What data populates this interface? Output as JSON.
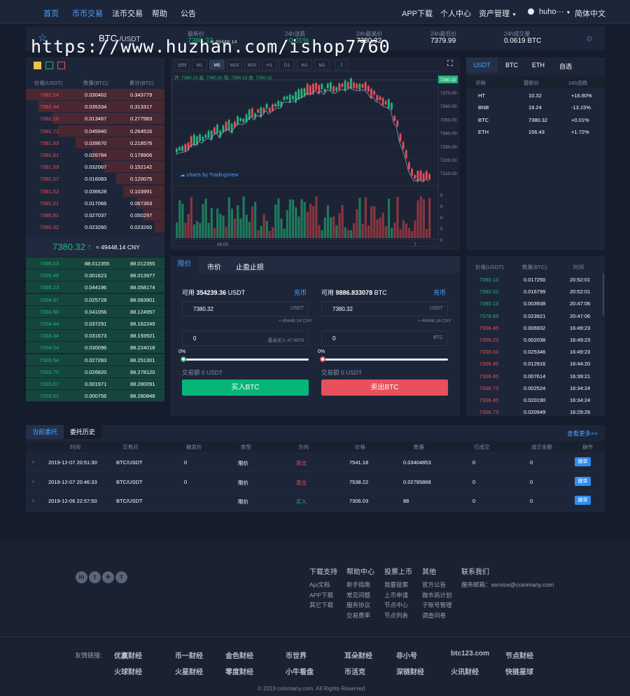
{
  "nav": {
    "left": [
      "首页",
      "币币交易",
      "法币交易",
      "帮助",
      "公告"
    ],
    "right": {
      "app": "APP下载",
      "center": "个人中心",
      "assets": "资产管理",
      "user": "huho···",
      "lang": "简体中文"
    }
  },
  "ticker": {
    "base": "BTC",
    "quote": "/USDT",
    "last_label": "最新价",
    "last": "7380.32",
    "last_cny": "¥ 49448.14",
    "change_label": "24h涨跌",
    "change": "+0.01%",
    "high_label": "24h最高价",
    "high": "7380.32",
    "low_label": "24h最低价",
    "low": "7379.99",
    "vol_label": "24h成交量",
    "vol": "0.0619 BTC"
  },
  "watermark": "https://www.huzhan.com/ishop7760",
  "orderbook": {
    "headers": [
      "价格(USDT)",
      "数量(BTC)",
      "累计(BTC)"
    ],
    "asks": [
      {
        "price": "7382.54",
        "qty": "0.030462",
        "total": "0.343779",
        "depth": 1.0
      },
      {
        "price": "7382.44",
        "qty": "0.035334",
        "total": "0.313317",
        "depth": 0.91
      },
      {
        "price": "7382.16",
        "qty": "0.013467",
        "total": "0.277983",
        "depth": 0.81
      },
      {
        "price": "7381.71",
        "qty": "0.045940",
        "total": "0.264516",
        "depth": 0.77
      },
      {
        "price": "7381.63",
        "qty": "0.039670",
        "total": "0.218576",
        "depth": 0.64
      },
      {
        "price": "7381.61",
        "qty": "0.026784",
        "total": "0.178906",
        "depth": 0.52
      },
      {
        "price": "7381.59",
        "qty": "0.032067",
        "total": "0.152142",
        "depth": 0.44
      },
      {
        "price": "7381.57",
        "qty": "0.016083",
        "total": "0.120075",
        "depth": 0.35
      },
      {
        "price": "7381.52",
        "qty": "0.036628",
        "total": "0.103991",
        "depth": 0.3
      },
      {
        "price": "7381.01",
        "qty": "0.017066",
        "total": "0.067363",
        "depth": 0.2
      },
      {
        "price": "7380.81",
        "qty": "0.027037",
        "total": "0.050297",
        "depth": 0.15
      },
      {
        "price": "7380.32",
        "qty": "0.023260",
        "total": "0.023260",
        "depth": 0.07
      }
    ],
    "mid_price": "7380.32",
    "mid_arrow": "↑",
    "mid_cny": "≈ 49448.14 CNY",
    "bids": [
      {
        "price": "7306.03",
        "qty": "88.012355",
        "total": "88.012355",
        "depth": 1.0
      },
      {
        "price": "7305.48",
        "qty": "0.001623",
        "total": "88.013977",
        "depth": 1.0
      },
      {
        "price": "7305.23",
        "qty": "0.044196",
        "total": "88.058174",
        "depth": 1.0
      },
      {
        "price": "7304.97",
        "qty": "0.025728",
        "total": "88.083901",
        "depth": 1.0
      },
      {
        "price": "7304.90",
        "qty": "0.041056",
        "total": "88.124957",
        "depth": 1.0
      },
      {
        "price": "7304.44",
        "qty": "0.037291",
        "total": "88.162249",
        "depth": 1.0
      },
      {
        "price": "7304.34",
        "qty": "0.031673",
        "total": "88.193921",
        "depth": 1.0
      },
      {
        "price": "7304.04",
        "qty": "0.030096",
        "total": "88.224018",
        "depth": 1.0
      },
      {
        "price": "7303.94",
        "qty": "0.027283",
        "total": "88.251301",
        "depth": 1.0
      },
      {
        "price": "7303.70",
        "qty": "0.026820",
        "total": "88.278120",
        "depth": 1.0
      },
      {
        "price": "7303.67",
        "qty": "0.001971",
        "total": "88.280091",
        "depth": 1.0
      },
      {
        "price": "7303.61",
        "qty": "0.000756",
        "total": "88.280848",
        "depth": 1.0
      }
    ]
  },
  "kchart": {
    "timeframes": [
      "分时",
      "M1",
      "M5",
      "M15",
      "M30",
      "H1",
      "D1",
      "W1",
      "M1"
    ],
    "active_tf": "M5",
    "ohlc": "开: 7380.13 高: 7380.32 低: 7380.13 收: 7380.32",
    "price_tag": "7380.32",
    "ticks": [
      "7370.00",
      "7360.00",
      "7350.00",
      "7340.00",
      "7330.00",
      "7320.00",
      "7310.00"
    ],
    "x_ticks": [
      "06:00",
      "7"
    ],
    "vol_ticks": [
      "0",
      "0",
      "0",
      "0",
      "0"
    ],
    "brand": "charts by TradingView"
  },
  "markets": {
    "tabs": [
      "USDT",
      "BTC",
      "ETH",
      "自选"
    ],
    "headers": [
      "币种",
      "最新价",
      "24h涨跌"
    ],
    "rows": [
      {
        "sym": "HT",
        "price": "10.32",
        "chg": "+16.80%",
        "up": true
      },
      {
        "sym": "BNB",
        "price": "19.24",
        "chg": "-13.15%",
        "up": false
      },
      {
        "sym": "BTC",
        "price": "7380.32",
        "chg": "+0.01%",
        "up": true
      },
      {
        "sym": "ETH",
        "price": "156.43",
        "chg": "+1.72%",
        "up": true
      }
    ]
  },
  "trade": {
    "tabs": [
      "限价",
      "市价",
      "止盈止损"
    ],
    "buy": {
      "avail_label": "可用",
      "avail": "354239.36",
      "unit": "USDT",
      "deposit": "充币",
      "price": "7380.32",
      "price_unit": "USDT",
      "cny": "≈ 49448.14 CNY",
      "amount": "0",
      "amount_hint": "最高买入:47.9978",
      "pct": "0%",
      "pct_value": 0,
      "total": "交易额 0 USDT",
      "button": "买入BTC"
    },
    "sell": {
      "avail_label": "可用",
      "avail": "9886.833078",
      "unit": "BTC",
      "deposit": "充币",
      "price": "7380.32",
      "price_unit": "USDT",
      "cny": "≈ 49448.14 CNY",
      "amount": "0",
      "amount_unit": "BTC",
      "pct": "0%",
      "pct_value": 0,
      "total": "交易额 0 USDT",
      "button": "卖出BTC"
    }
  },
  "trades": {
    "headers": [
      "价格(USDT)",
      "数量(BTC)",
      "时间"
    ],
    "rows": [
      {
        "price": "7380.13",
        "qty": "0.017250",
        "time": "20:52:01",
        "up": true
      },
      {
        "price": "7380.32",
        "qty": "0.016799",
        "time": "20:52:01",
        "up": true
      },
      {
        "price": "7380.13",
        "qty": "0.003938",
        "time": "20:47:06",
        "up": true
      },
      {
        "price": "7379.99",
        "qty": "0.023921",
        "time": "20:47:06",
        "up": true
      },
      {
        "price": "7306.45",
        "qty": "0.006932",
        "time": "16:49:23",
        "up": false
      },
      {
        "price": "7306.23",
        "qty": "0.002038",
        "time": "16:49:23",
        "up": false
      },
      {
        "price": "7306.03",
        "qty": "0.025346",
        "time": "16:49:23",
        "up": false
      },
      {
        "price": "7306.45",
        "qty": "0.012916",
        "time": "16:44:20",
        "up": false
      },
      {
        "price": "7306.45",
        "qty": "0.007614",
        "time": "16:39:21",
        "up": false
      },
      {
        "price": "7306.73",
        "qty": "0.002524",
        "time": "16:34:24",
        "up": false
      },
      {
        "price": "7306.45",
        "qty": "0.020190",
        "time": "16:34:24",
        "up": false
      },
      {
        "price": "7306.73",
        "qty": "0.020949",
        "time": "16:29:26",
        "up": false
      }
    ]
  },
  "orders": {
    "tabs": [
      "当前委托",
      "委托历史"
    ],
    "more": "查看更多>>",
    "headers": [
      "时间",
      "交易对",
      "触发价",
      "类型",
      "方向",
      "价格",
      "数量",
      "已成交",
      "成交金额",
      "操作"
    ],
    "rows": [
      {
        "time": "2019-12-07 20:51:30",
        "pair": "BTC/USDT",
        "trigger": "0",
        "type": "限价",
        "side": "卖出",
        "price": "7541.18",
        "qty": "0.03404853",
        "filled": "0",
        "amount": "0",
        "action": "撤单",
        "buy": false
      },
      {
        "time": "2019-12-07 20:46:33",
        "pair": "BTC/USDT",
        "trigger": "0",
        "type": "限价",
        "side": "卖出",
        "price": "7538.22",
        "qty": "0.02785868",
        "filled": "0",
        "amount": "0",
        "action": "撤单",
        "buy": false
      },
      {
        "time": "2019-12-06 22:57:50",
        "pair": "BTC/USDT",
        "trigger": "",
        "type": "限价",
        "side": "买入",
        "price": "7306.03",
        "qty": "88",
        "filled": "0",
        "amount": "0",
        "action": "撤单",
        "buy": true
      }
    ]
  },
  "footer": {
    "cols": [
      {
        "title": "下载支持",
        "links": [
          "Api文档",
          "APP下载",
          "其它下载"
        ]
      },
      {
        "title": "帮助中心",
        "links": [
          "新手指南",
          "常见问题",
          "服务协议",
          "交易费率"
        ]
      },
      {
        "title": "投票上币",
        "links": [
          "我要投票",
          "上币申请",
          "节点中心",
          "节点列表"
        ]
      },
      {
        "title": "其他",
        "links": [
          "官方公告",
          "做市商计划",
          "子账号管理",
          "调查问卷"
        ]
      }
    ],
    "contact_title": "联系我们",
    "contact": "服务邮箱：service@coinmany.com",
    "social": [
      "in",
      "t",
      "✈",
      "f"
    ],
    "partners_label": "友情链接:",
    "partners": [
      "优赢财经",
      "币一财经",
      "金色财经",
      "币世界",
      "耳朵财经",
      "非小号",
      "btc123.com",
      "节点财经",
      "火球财经",
      "火星财经",
      "零度财经",
      "小牛看盘",
      "币活克",
      "深链财经",
      "火讯财经",
      "快链星球"
    ],
    "copyright": "© 2019 coinmany.com. All Rights Reserved"
  },
  "colors": {
    "up": "#26b37d",
    "down": "#e8505b",
    "accent": "#4aa3ff",
    "bg": "#151c2c",
    "panel": "#1d2639"
  }
}
